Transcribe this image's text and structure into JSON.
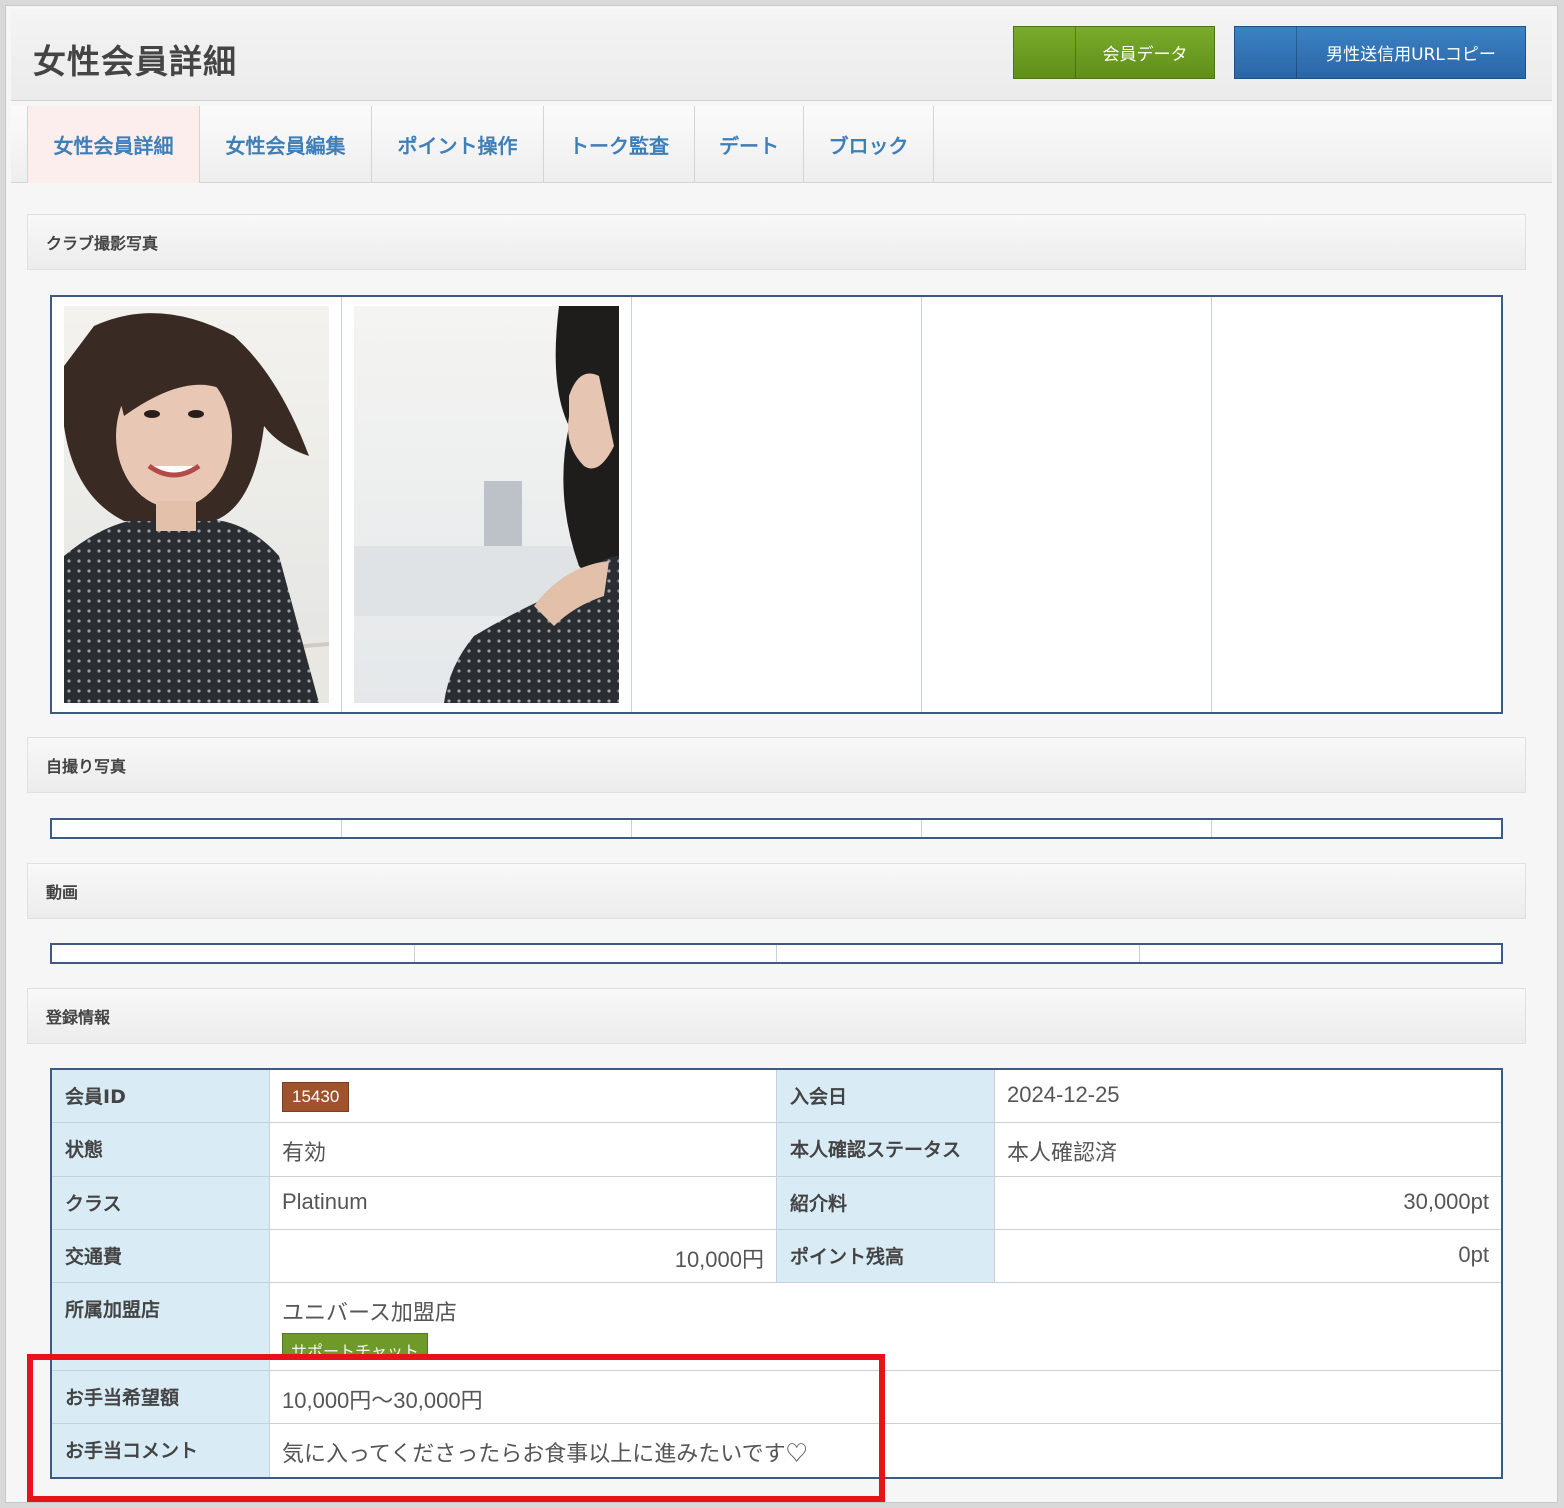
{
  "header": {
    "title": "女性会員詳細",
    "member_data_button": "会員データ",
    "copy_url_button": "男性送信用URLコピー"
  },
  "tabs": [
    "女性会員詳細",
    "女性会員編集",
    "ポイント操作",
    "トーク監査",
    "デート",
    "ブロック"
  ],
  "sections": {
    "club_photos": "クラブ撮影写真",
    "selfie_photos": "自撮り写真",
    "videos": "動画",
    "registration": "登録情報"
  },
  "registration": {
    "member_id_label": "会員ID",
    "member_id": "15430",
    "join_date_label": "入会日",
    "join_date": "2024-12-25",
    "status_label": "状態",
    "status": "有効",
    "identity_label": "本人確認ステータス",
    "identity": "本人確認済",
    "class_label": "クラス",
    "class": "Platinum",
    "referral_fee_label": "紹介料",
    "referral_fee": "30,000pt",
    "transport_label": "交通費",
    "transport": "10,000円",
    "points_label": "ポイント残高",
    "points": "0pt",
    "store_label": "所属加盟店",
    "store": "ユニバース加盟店",
    "support_chat": "サポートチャット",
    "allowance_label": "お手当希望額",
    "allowance": "10,000円〜30,000円",
    "comment_label": "お手当コメント",
    "comment": "気に入ってくださったらお食事以上に進みたいです♡"
  },
  "colors": {
    "tab_text": "#3f7fb8",
    "green_button": "#6a9b22",
    "blue_button": "#2f70b3",
    "badge": "#a0522d",
    "highlight": "#e8121b"
  }
}
